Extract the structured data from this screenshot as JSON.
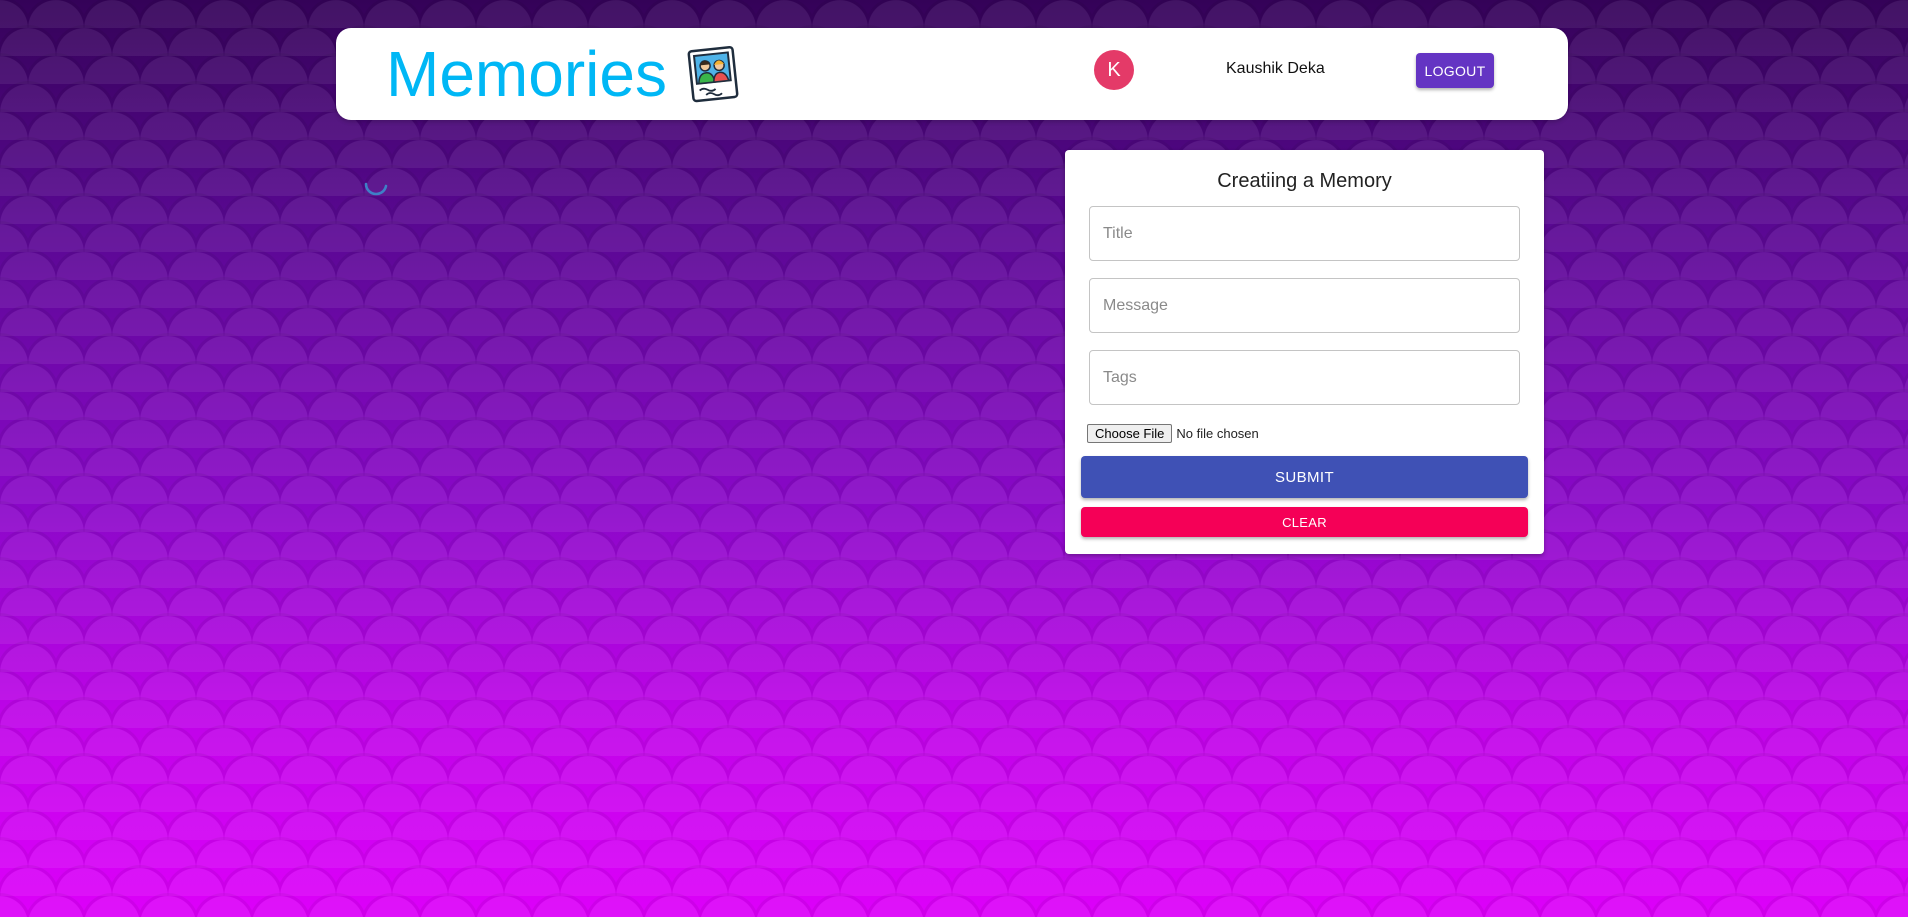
{
  "header": {
    "title": "Memories",
    "logo_icon": "photo-memories-icon",
    "brand_color": "#00b7f5"
  },
  "user": {
    "avatar_initial": "K",
    "avatar_color": "#e43a68",
    "name": "Kaushik Deka"
  },
  "logout_label": "LOGOUT",
  "posts": {
    "loading_icon": "loading-spinner-icon"
  },
  "form": {
    "title": "Creatiing a Memory",
    "title_placeholder": "Title",
    "message_placeholder": "Message",
    "tags_placeholder": "Tags",
    "file_button_label": "Choose File",
    "file_status": "No file chosen",
    "submit_label": "SUBMIT",
    "clear_label": "CLEAR",
    "submit_color": "#3f51b5",
    "clear_color": "#f50057"
  }
}
